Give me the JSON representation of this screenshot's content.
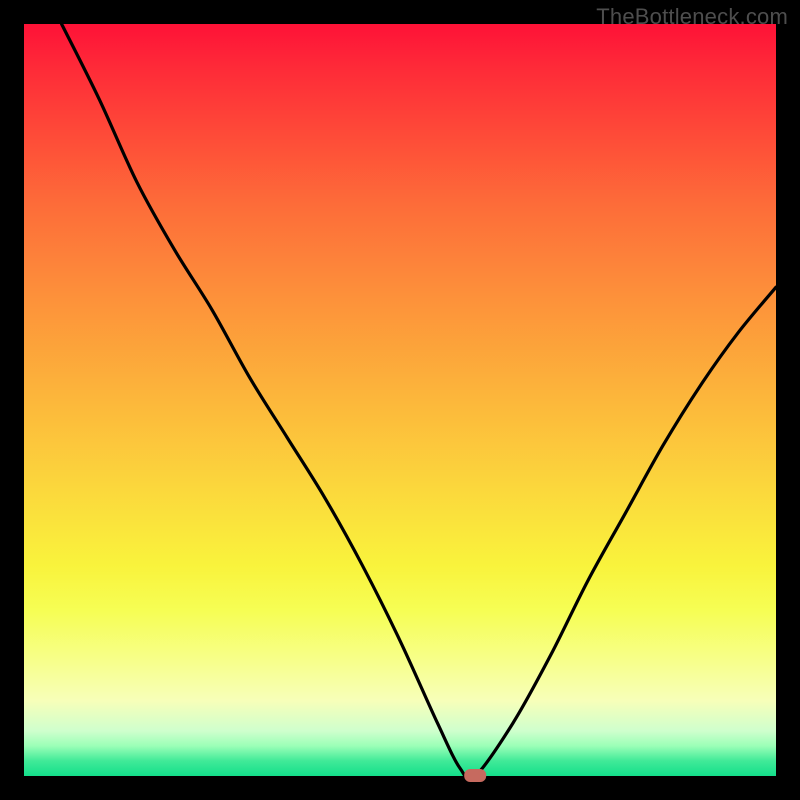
{
  "watermark": "TheBottleneck.com",
  "chart_data": {
    "type": "line",
    "title": "",
    "xlabel": "",
    "ylabel": "",
    "xlim": [
      0,
      100
    ],
    "ylim": [
      0,
      100
    ],
    "grid": false,
    "series": [
      {
        "name": "bottleneck-curve",
        "x": [
          5,
          10,
          15,
          20,
          25,
          30,
          35,
          40,
          45,
          50,
          55,
          58,
          60,
          65,
          70,
          75,
          80,
          85,
          90,
          95,
          100
        ],
        "values": [
          100,
          90,
          79,
          70,
          62,
          53,
          45,
          37,
          28,
          18,
          7,
          1,
          0,
          7,
          16,
          26,
          35,
          44,
          52,
          59,
          65
        ]
      }
    ],
    "marker": {
      "x": 60,
      "y": 0,
      "color": "#c66a5f"
    },
    "background_gradient": {
      "direction": "vertical",
      "stops": [
        {
          "y": 100,
          "color": "#fe1237"
        },
        {
          "y": 50,
          "color": "#fcb73b"
        },
        {
          "y": 25,
          "color": "#f9f33c"
        },
        {
          "y": 5,
          "color": "#9bffb7"
        },
        {
          "y": 0,
          "color": "#13df8b"
        }
      ]
    }
  }
}
